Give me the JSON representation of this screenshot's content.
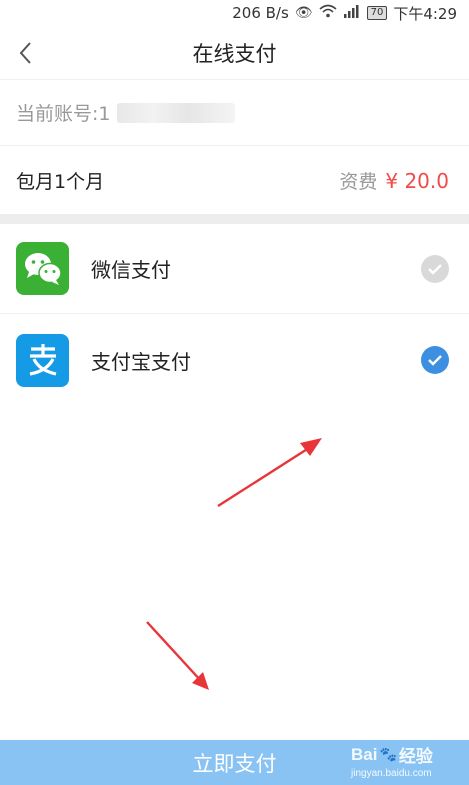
{
  "status_bar": {
    "speed": "206 B/s",
    "battery": "70",
    "time": "下午4:29"
  },
  "nav": {
    "title": "在线支付"
  },
  "account": {
    "label": "当前账号:1"
  },
  "plan": {
    "name": "包月1个月",
    "fee_label": "资费",
    "fee_price": "¥ 20.0"
  },
  "payment_methods": [
    {
      "label": "微信支付",
      "icon": "wechat-icon",
      "selected": false
    },
    {
      "label": "支付宝支付",
      "icon": "alipay-icon",
      "selected": true
    }
  ],
  "pay_button": {
    "label": "立即支付"
  },
  "watermark": {
    "brand": "Bai",
    "brand2": "经验",
    "sub": "jingyan.baidu.com"
  },
  "colors": {
    "accent_red": "#f24a48",
    "wechat_green": "#3ab035",
    "alipay_blue": "#159ae6",
    "button_blue": "#89c3f4",
    "annotation_arrow": "#e8353a"
  }
}
